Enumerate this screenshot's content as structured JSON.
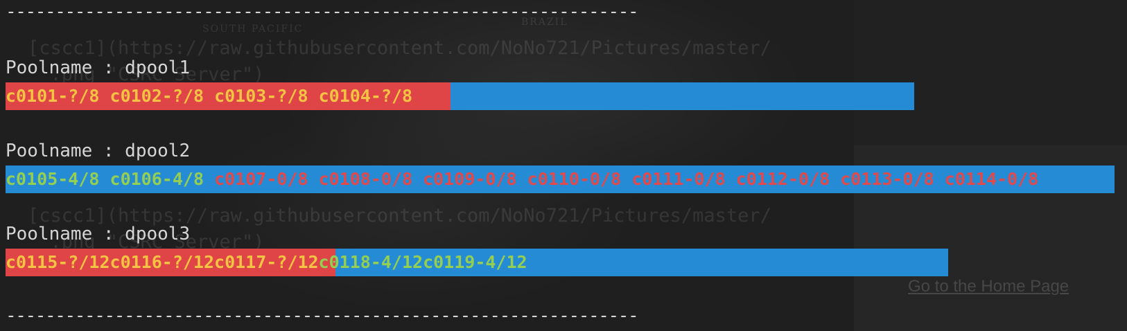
{
  "colors": {
    "background": "#1f1f1f",
    "text": "#d6d6d6",
    "bar_red": "#df4446",
    "bar_blue": "#258bd4",
    "node_yellow": "#f4c343",
    "node_green": "#94ce52",
    "node_red": "#e04a4c"
  },
  "separator": "----------------------------------------------------------------",
  "pools": [
    {
      "label": "Poolname : dpool1",
      "used_fraction": 0.49,
      "nodes": [
        {
          "text": "c0101-?/8",
          "color": "yellow"
        },
        {
          "text": "c0102-?/8",
          "color": "yellow"
        },
        {
          "text": "c0103-?/8",
          "color": "yellow"
        },
        {
          "text": "c0104-?/8",
          "color": "yellow"
        }
      ]
    },
    {
      "label": "Poolname : dpool2",
      "used_fraction": 0,
      "nodes": [
        {
          "text": "c0105-4/8",
          "color": "green"
        },
        {
          "text": "c0106-4/8",
          "color": "green"
        },
        {
          "text": "c0107-0/8",
          "color": "red"
        },
        {
          "text": "c0108-0/8",
          "color": "red"
        },
        {
          "text": "c0109-0/8",
          "color": "red"
        },
        {
          "text": "c0110-0/8",
          "color": "red"
        },
        {
          "text": "c0111-0/8",
          "color": "red"
        },
        {
          "text": "c0112-0/8",
          "color": "red"
        },
        {
          "text": "c0113-0/8",
          "color": "red"
        },
        {
          "text": "c0114-0/8",
          "color": "red"
        }
      ]
    },
    {
      "label": "Poolname : dpool3",
      "used_fraction": 0.35,
      "nodes": [
        {
          "text": "c0115-?/12",
          "color": "yellow"
        },
        {
          "text": "c0116-?/12",
          "color": "yellow"
        },
        {
          "text": "c0117-?/12",
          "color": "yellow"
        },
        {
          "text": "c0118-4/12",
          "color": "green"
        },
        {
          "text": "c0119-4/12",
          "color": "green"
        }
      ]
    }
  ],
  "background": {
    "map_labels": [
      "SOUTH  PACIFIC",
      "BRAZIL"
    ],
    "overlay_lines": [
      "[cscc1](https://raw.githubusercontent.com/NoNo721/Pictures/master/",
      "  .png \"CSRC Server\")",
      "[cscc1](https://raw.githubusercontent.com/NoNo721/Pictures/master/",
      "  .png \"CSRC Server\")"
    ],
    "side_link": "Go to the Home Page"
  }
}
